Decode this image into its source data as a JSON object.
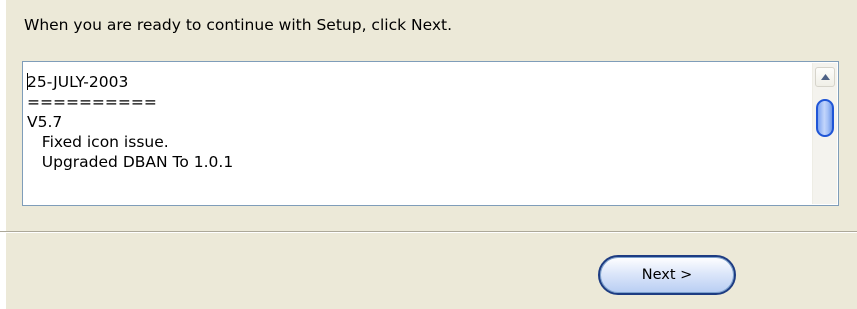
{
  "instruction": "When you are ready to continue with Setup, click Next.",
  "memo": {
    "lines": [
      "25-JULY-2003",
      "==========",
      "V5.7",
      "   Fixed icon issue.",
      "   Upgraded DBAN To 1.0.1"
    ]
  },
  "scrollbar": {
    "up_icon": "triangle-up-icon"
  },
  "buttons": {
    "next": "Next >"
  },
  "colors": {
    "panel": "#ece9d8",
    "memo_border": "#7f9db9",
    "button_border": "#1d3c82",
    "scroll_thumb_border": "#1f55d6"
  }
}
